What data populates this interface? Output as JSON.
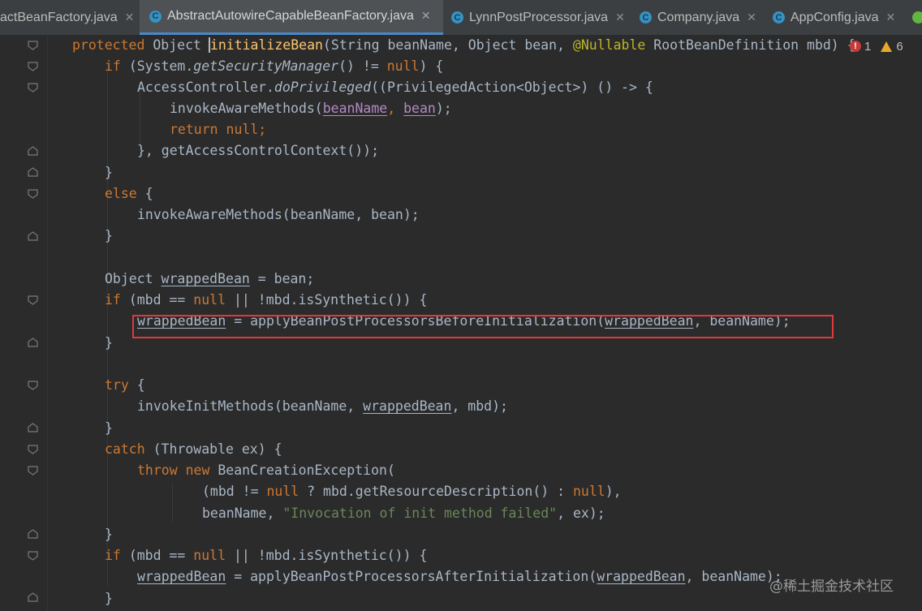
{
  "tabs": [
    {
      "label": "actBeanFactory.java",
      "icon": "class-icon",
      "active": false
    },
    {
      "label": "AbstractAutowireCapableBeanFactory.java",
      "icon": "abstract-class-icon",
      "active": true
    },
    {
      "label": "LynnPostProcessor.java",
      "icon": "class-icon",
      "active": false
    },
    {
      "label": "Company.java",
      "icon": "class-icon",
      "active": false
    },
    {
      "label": "AppConfig.java",
      "icon": "class-icon",
      "active": false
    }
  ],
  "tab_close_glyph": "✕",
  "tab_icon_letter": "C",
  "inspections": {
    "errors": "1",
    "warnings": "6"
  },
  "code": {
    "l1": {
      "kw": "protected ",
      "type": "Object ",
      "method": "initializeBean",
      "p1": "(String beanName, Object bean, ",
      "ann": "@Nullable",
      "p2": " RootBeanDefinition mbd) {"
    },
    "l2": {
      "kw1": "if ",
      "a": "(System.",
      "call": "getSecurityManager",
      "b": "() != ",
      "kw2": "null",
      "c": ") {"
    },
    "l3": {
      "a": "AccessController.",
      "call": "doPrivileged",
      "b": "((PrivilegedAction<Object>) () -> {"
    },
    "l4": {
      "a": "invokeAwareMethods(",
      "v1": "beanName",
      "sep": ", ",
      "v2": "bean",
      "b": ");"
    },
    "l5": {
      "kw": "return ",
      "kw2": "null",
      "b": ";"
    },
    "l6": {
      "a": "}, getAccessControlContext());"
    },
    "l7": {
      "a": "}"
    },
    "l8": {
      "kw": "else",
      "b": " {"
    },
    "l9": {
      "a": "invokeAwareMethods(beanName, bean);"
    },
    "l10": {
      "a": "}"
    },
    "l11": {
      "a": "Object ",
      "v": "wrappedBean",
      "b": " = bean;"
    },
    "l12": {
      "kw": "if ",
      "a": "(mbd == ",
      "kw2": "null",
      "b": " || !mbd.isSynthetic()) {"
    },
    "l13": {
      "v1": "wrappedBean",
      "a": " = applyBeanPostProcessorsBeforeInitialization(",
      "v2": "wrappedBean",
      "b": ", beanName);"
    },
    "l14": {
      "a": "}"
    },
    "l15": {
      "kw": "try",
      "b": " {"
    },
    "l16": {
      "a": "invokeInitMethods(beanName, ",
      "v": "wrappedBean",
      "b": ", mbd);"
    },
    "l17": {
      "a": "}"
    },
    "l18": {
      "kw": "catch",
      "b": " (Throwable ex) {"
    },
    "l19": {
      "kw": "throw new ",
      "a": "BeanCreationException("
    },
    "l20": {
      "a": "(mbd != ",
      "kw": "null",
      "b": " ? mbd.getResourceDescription() : ",
      "kw2": "null",
      "c": "),"
    },
    "l21": {
      "a": "beanName, ",
      "str": "\"Invocation of init method failed\"",
      "b": ", ex);"
    },
    "l22": {
      "a": "}"
    },
    "l23": {
      "kw": "if ",
      "a": "(mbd == ",
      "kw2": "null",
      "b": " || !mbd.isSynthetic()) {"
    },
    "l24": {
      "v1": "wrappedBean",
      "a": " = applyBeanPostProcessorsAfterInitialization(",
      "v2": "wrappedBean",
      "b": ", beanName);"
    },
    "l25": {
      "a": "}"
    }
  },
  "watermark": "@稀土掘金技术社区",
  "colors": {
    "keyword": "#cc7832",
    "annotation": "#bbb529",
    "string": "#6a8759",
    "method_decl": "#ffc66d",
    "param": "#b389c5",
    "highlight_box": "#e0393c",
    "active_tab_underline": "#4a88c7"
  }
}
